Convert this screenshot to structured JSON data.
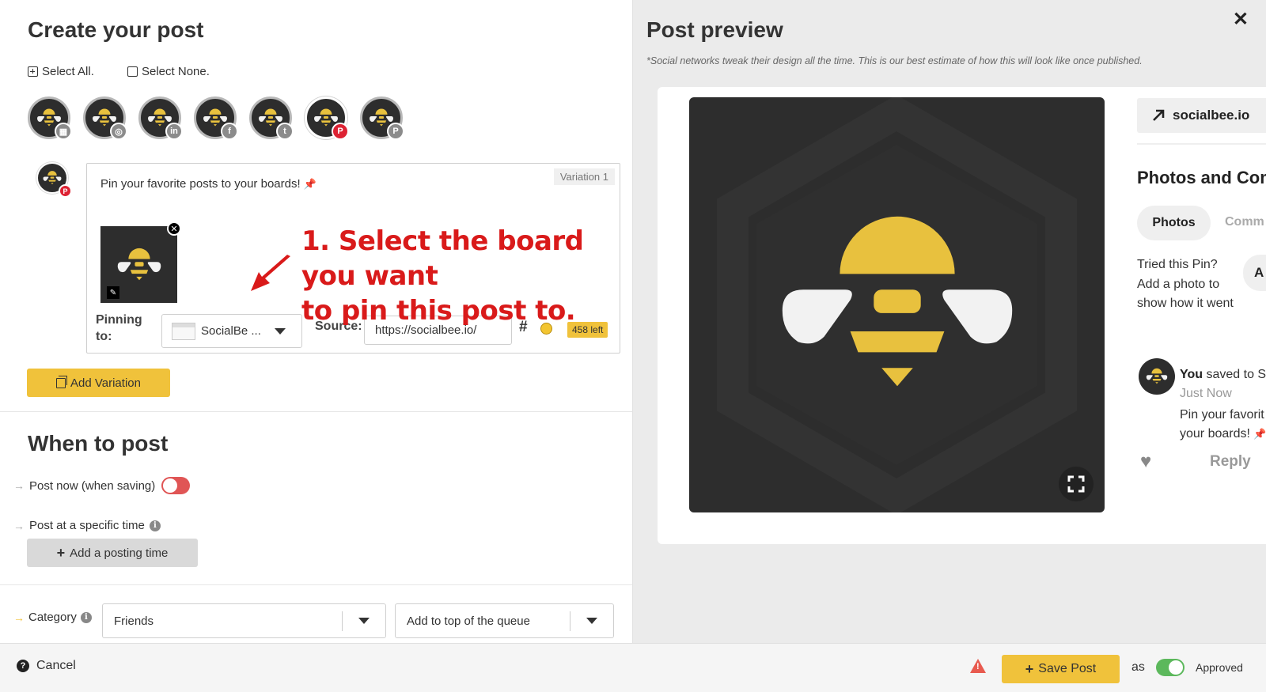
{
  "left": {
    "title": "Create your post",
    "select_all": "Select All.",
    "select_none": "Select None.",
    "accounts": [
      {
        "network": "google-business",
        "badge": "▦",
        "active": false
      },
      {
        "network": "instagram",
        "badge": "◎",
        "active": false
      },
      {
        "network": "linkedin",
        "badge": "in",
        "active": false
      },
      {
        "network": "facebook",
        "badge": "f",
        "active": false
      },
      {
        "network": "twitter",
        "badge": "t",
        "active": false
      },
      {
        "network": "pinterest",
        "badge": "P",
        "active": true
      },
      {
        "network": "pinterest",
        "badge": "P",
        "active": false
      }
    ],
    "editor": {
      "variation_label": "Variation 1",
      "post_text": "Pin your favorite posts to your boards!",
      "pinning_to_label": "Pinning to:",
      "board_name": "SocialBe ...",
      "source_label": "Source:",
      "source_value": "https://socialbee.io/",
      "hash_symbol": "#",
      "chars_left": "458 left"
    },
    "annotation_line1": "1. Select the board you want",
    "annotation_line2": "to pin this post to.",
    "add_variation": "Add Variation",
    "when_title": "When to post",
    "post_now": "Post now (when saving)",
    "post_specific": "Post at a specific time",
    "add_time": "Add a posting time",
    "category_label": "Category",
    "category_value": "Friends",
    "queue_value": "Add to top of the queue"
  },
  "right": {
    "title": "Post preview",
    "disclaimer": "*Social networks tweak their design all the time. This is our best estimate of how this will look like once published.",
    "site": "socialbee.io",
    "photos_heading": "Photos and Com",
    "tab_photos": "Photos",
    "tab_comments": "Comm",
    "tried_text": "Tried this Pin? Add a photo to show how it went",
    "add_photo_btn": "A",
    "comment": {
      "you": "You",
      "saved_to": "saved to S",
      "time": "Just Now",
      "line1": "Pin your favorit",
      "line2": "your boards!",
      "reply": "Reply"
    }
  },
  "footer": {
    "cancel": "Cancel",
    "save": "Save Post",
    "as": "as",
    "status": "Approved"
  },
  "colors": {
    "accent_yellow": "#f0c23b",
    "bee_yellow": "#e8c13e",
    "dark_bg": "#2d2d2d",
    "toggle_off": "#e05555",
    "toggle_on": "#5cb85c",
    "annotation_red": "#d91a1a"
  }
}
